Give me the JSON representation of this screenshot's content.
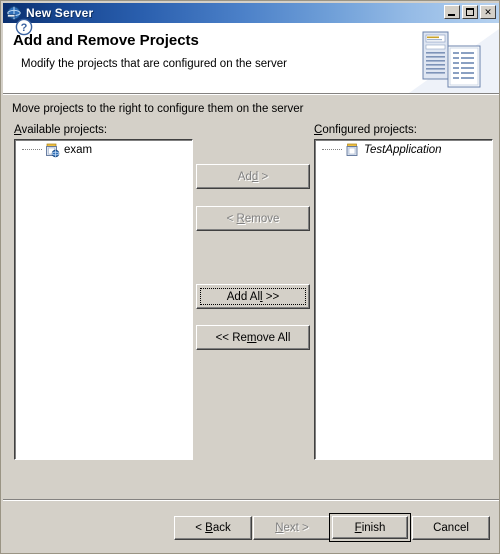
{
  "window": {
    "title": "New Server",
    "title_icon": "server-globe-icon",
    "controls": {
      "minimize": "minimize-button",
      "maximize": "maximize-button",
      "close_label": "✕"
    }
  },
  "header": {
    "title": "Add and Remove Projects",
    "subtitle": "Modify the projects that are configured on the server",
    "graphic": "server-and-document-icon"
  },
  "body": {
    "instruction": "Move projects to the right to configure them on the server",
    "available": {
      "label_mnemonic": "A",
      "label_rest": "vailable projects:",
      "items": [
        {
          "name": "exam",
          "icon": "project-folder-icon",
          "italic": false
        }
      ]
    },
    "configured": {
      "label_mnemonic": "C",
      "label_rest": "onfigured projects:",
      "items": [
        {
          "name": "TestApplication",
          "icon": "project-folder-icon",
          "italic": true
        }
      ]
    },
    "transfer_buttons": [
      {
        "id": "add",
        "pre": "Ad",
        "mn": "d",
        "post": " >",
        "enabled": false,
        "focused": false
      },
      {
        "id": "remove",
        "pre": "< ",
        "mn": "R",
        "post": "emove",
        "enabled": false,
        "focused": false
      },
      {
        "id": "add-all",
        "pre": "Add Al",
        "mn": "l",
        "post": " >>",
        "enabled": true,
        "focused": true
      },
      {
        "id": "remove-all",
        "pre": "<< Re",
        "mn": "m",
        "post": "ove All",
        "enabled": true,
        "focused": false
      }
    ]
  },
  "footer": {
    "help_icon": "help-question-icon",
    "buttons": [
      {
        "id": "back",
        "pre": "< ",
        "mn": "B",
        "post": "ack",
        "enabled": true,
        "default": false
      },
      {
        "id": "next",
        "pre": "",
        "mn": "N",
        "post": "ext >",
        "enabled": false,
        "default": false
      },
      {
        "id": "finish",
        "pre": "",
        "mn": "F",
        "post": "inish",
        "enabled": true,
        "default": true
      },
      {
        "id": "cancel",
        "pre": "Cancel",
        "mn": "",
        "post": "",
        "enabled": true,
        "default": false
      }
    ]
  },
  "colors": {
    "dialog_face": "#d4d0c8",
    "title_gradient_start": "#0a2f6f",
    "title_gradient_end": "#b6d2f0",
    "text": "#000000",
    "disabled_text": "#808080",
    "list_background": "#ffffff",
    "accent_blue": "#4b6fa8"
  }
}
